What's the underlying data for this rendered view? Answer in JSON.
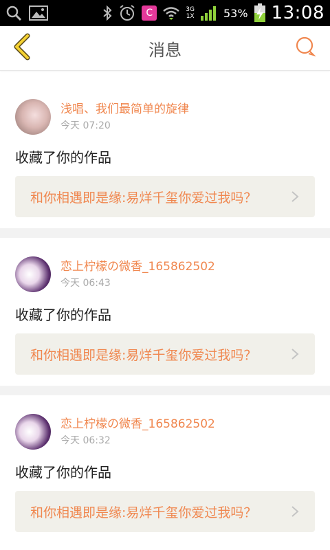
{
  "status_bar": {
    "battery_percent": "53%",
    "time": "13:08",
    "network": "3G",
    "network_sub": "1X",
    "app_badge": "C",
    "icons": [
      "search-icon",
      "gallery-icon",
      "bluetooth-icon",
      "alarm-icon",
      "app-badge-icon",
      "wifi-icon",
      "signal-icon",
      "battery-charging-icon"
    ]
  },
  "header": {
    "title": "消息",
    "back_icon": "chevron-left-icon",
    "chat_icon": "chat-bubble-icon"
  },
  "accent_color": "#f0874f",
  "messages": [
    {
      "username": "浅唱、我们最简单的旋律",
      "time": "今天 07:20",
      "action": "收藏了你的作品",
      "work_title": "和你相遇即是缘:易烊千玺你爱过我吗？"
    },
    {
      "username": "恋上柠檬の微香_165862502",
      "time": "今天 06:43",
      "action": "收藏了你的作品",
      "work_title": "和你相遇即是缘:易烊千玺你爱过我吗？"
    },
    {
      "username": "恋上柠檬の微香_165862502",
      "time": "今天 06:32",
      "action": "收藏了你的作品",
      "work_title": "和你相遇即是缘:易烊千玺你爱过我吗？"
    }
  ]
}
